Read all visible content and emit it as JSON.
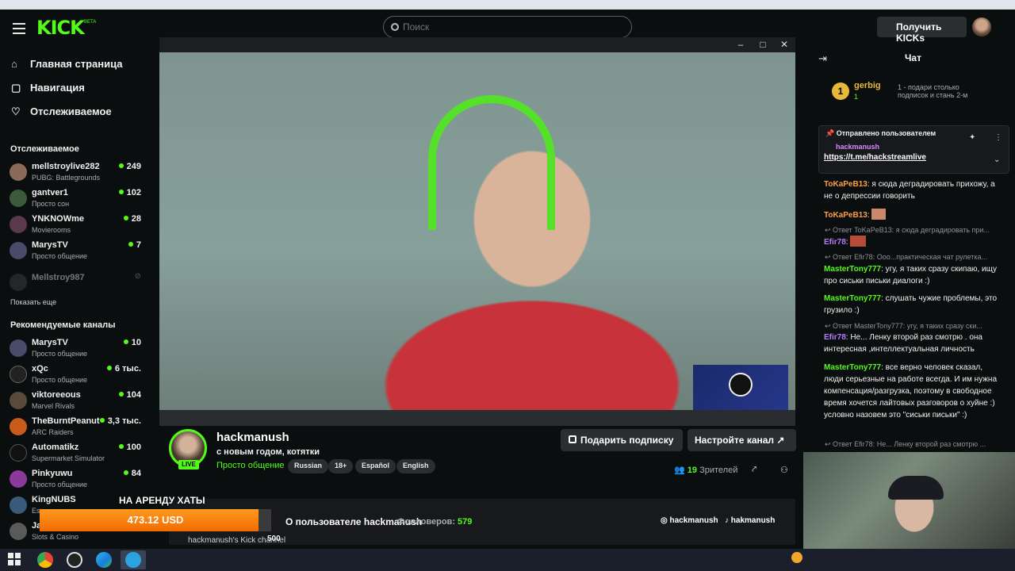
{
  "topbar": {
    "logo": "KICK",
    "logo_beta": "BETA",
    "search_placeholder": "Поиск",
    "kicks_button": "Получить KICKs"
  },
  "sidebar": {
    "nav": [
      {
        "label": "Главная страница",
        "icon": "home-icon"
      },
      {
        "label": "Навигация",
        "icon": "compass-icon"
      },
      {
        "label": "Отслеживаемое",
        "icon": "heart-icon"
      }
    ],
    "following_title": "Отслеживаемое",
    "following": [
      {
        "name": "mellstroylive282",
        "sub": "PUBG: Battlegrounds",
        "count": "249",
        "color": "#8a6b5a"
      },
      {
        "name": "gantver1",
        "sub": "Просто сон",
        "count": "102",
        "color": "#3c5a3a"
      },
      {
        "name": "YNKNOWme",
        "sub": "Movierooms",
        "count": "28",
        "color": "#5a3a4a"
      },
      {
        "name": "MarysTV",
        "sub": "Просто общение",
        "count": "7",
        "color": "#4a4a6a"
      },
      {
        "name": "Mellstroy987",
        "sub": "",
        "count": "",
        "color": "#444"
      }
    ],
    "show_more": "Показать еще",
    "recommended_title": "Рекомендуемые каналы",
    "recommended": [
      {
        "name": "MarysTV",
        "sub": "Просто общение",
        "count": "10",
        "color": "#4a4a6a"
      },
      {
        "name": "xQc",
        "sub": "Просто общение",
        "count": "6 тыс.",
        "color": "#222"
      },
      {
        "name": "viktoreeous",
        "sub": "Marvel Rivals",
        "count": "104",
        "color": "#5a4a3a"
      },
      {
        "name": "TheBurntPeanut",
        "sub": "ARC Raiders",
        "count": "3,3 тыс.",
        "color": "#c85a1a"
      },
      {
        "name": "Automatikz",
        "sub": "Supermarket Simulator",
        "count": "100",
        "color": "#111"
      },
      {
        "name": "Pinkyuwu",
        "sub": "Просто общение",
        "count": "84",
        "color": "#8a3a9a"
      },
      {
        "name": "KingNUBS",
        "sub": "Es",
        "count": "",
        "color": "#3a5a7a"
      },
      {
        "name": "Ja",
        "sub": "Slots & Casino",
        "count": "",
        "color": "#5a5a5a"
      }
    ]
  },
  "stream": {
    "live": "LIVE",
    "streamer": "hackmanush",
    "title": "с новым годом, котятки",
    "category": "Просто общение",
    "tags": [
      "Russian",
      "18+",
      "Español",
      "English"
    ],
    "gift_button": "Подарить подписку",
    "setup_button": "Настройте канал",
    "viewers_count": "19",
    "viewers_label": "Зрителей"
  },
  "about": {
    "title": "О пользователе hackmanush",
    "followers_label": "Фолловеров:",
    "followers_count": "579",
    "subtitle": "hackmanush's Kick channel",
    "instagram": "hackmanush",
    "tiktok": "hakmanush"
  },
  "overlay": {
    "rent_title": "НА АРЕНДУ ХАТЫ",
    "amount": "473.12 USD",
    "goal": "500",
    "progress": 0.946
  },
  "chat": {
    "title": "Чат",
    "gifter_rank": "1",
    "gifter_name": "gerbig",
    "gifter_count": "1",
    "gift_hint": "1 - подари столько подписок и стань 2-м",
    "pinned_by": "Отправлено пользователем",
    "pinned_user": "hackmanush",
    "pinned_link": "https://t.me/hackstreamlive",
    "messages": [
      {
        "user": "ToKaPeB13",
        "color": "#ff9f45",
        "text": "я сюда деградировать прихожу, а не о депрессии говорить"
      },
      {
        "user": "ToKaPeB13",
        "color": "#ff9f45",
        "text": ""
      },
      {
        "reply": "Ответ ToKaPeB13: я сюда деградировать при..."
      },
      {
        "user": "Efir78",
        "color": "#b57cff",
        "text": ""
      },
      {
        "reply": "Ответ Efir78: Ооо...практическая чат рулетка..."
      },
      {
        "user": "MasterTony777",
        "color": "#53fc18",
        "text": "угу, я таких сразу скипаю, ищу про сиськи письки диалоги :)"
      },
      {
        "user": "MasterTony777",
        "color": "#53fc18",
        "text": "слушать чужие проблемы, это грузило :)"
      },
      {
        "reply": "Ответ MasterTony777: угу, я таких сразу ски..."
      },
      {
        "user": "Efir78",
        "color": "#b57cff",
        "text": "Не... Ленку второй раз смотрю . она интересная ,интеллектуальная личность"
      },
      {
        "user": "MasterTony777",
        "color": "#53fc18",
        "text": "все верно человек сказал, люди серьезные на работе всегда. И им нужна компенсация/разгрузка, поэтому в свободное время хочется лайтовых разговоров о хуйне :) условно назовем это \"сиськи письки\" :)"
      },
      {
        "reply": "Ответ Efir78: Не... Ленку второй раз смотрю ..."
      }
    ]
  }
}
